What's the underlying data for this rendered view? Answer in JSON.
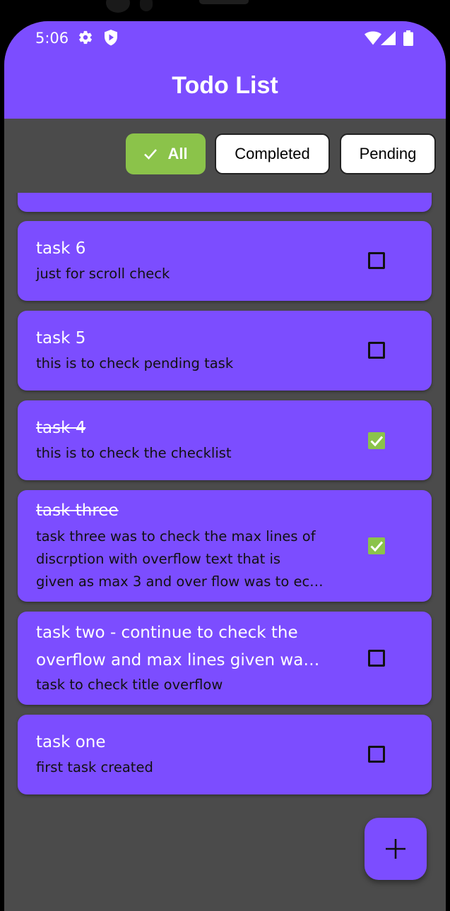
{
  "status_bar": {
    "time": "5:06",
    "icons": [
      "gear-icon",
      "shield-play-icon",
      "wifi-icon",
      "cell-signal-icon",
      "battery-icon"
    ]
  },
  "app_bar": {
    "title": "Todo List"
  },
  "filters": {
    "all": "All",
    "completed": "Completed",
    "pending": "Pending",
    "selected": "All"
  },
  "tasks": [
    {
      "title": "task 6",
      "description": "just for scroll check",
      "completed": false
    },
    {
      "title": "task 5",
      "description": "this is to check pending task",
      "completed": false
    },
    {
      "title": "task 4",
      "description": "this is to check the checklist",
      "completed": true
    },
    {
      "title": "task three",
      "description_lines": [
        "task three was to check the max lines of",
        "discrption with overflow text that is",
        "given as max 3 and over flow was to ec…"
      ],
      "completed": true
    },
    {
      "title_lines": [
        "task two - continue to check the",
        "overflow and max lines given wa…"
      ],
      "description": "task to check title overflow",
      "completed": false
    },
    {
      "title": "task one",
      "description": "first task created",
      "completed": false
    }
  ],
  "fab": {
    "icon": "plus-icon"
  },
  "colors": {
    "primary": "#7c4dff",
    "accent_green": "#8bc34a",
    "background": "#4b4b4b"
  }
}
